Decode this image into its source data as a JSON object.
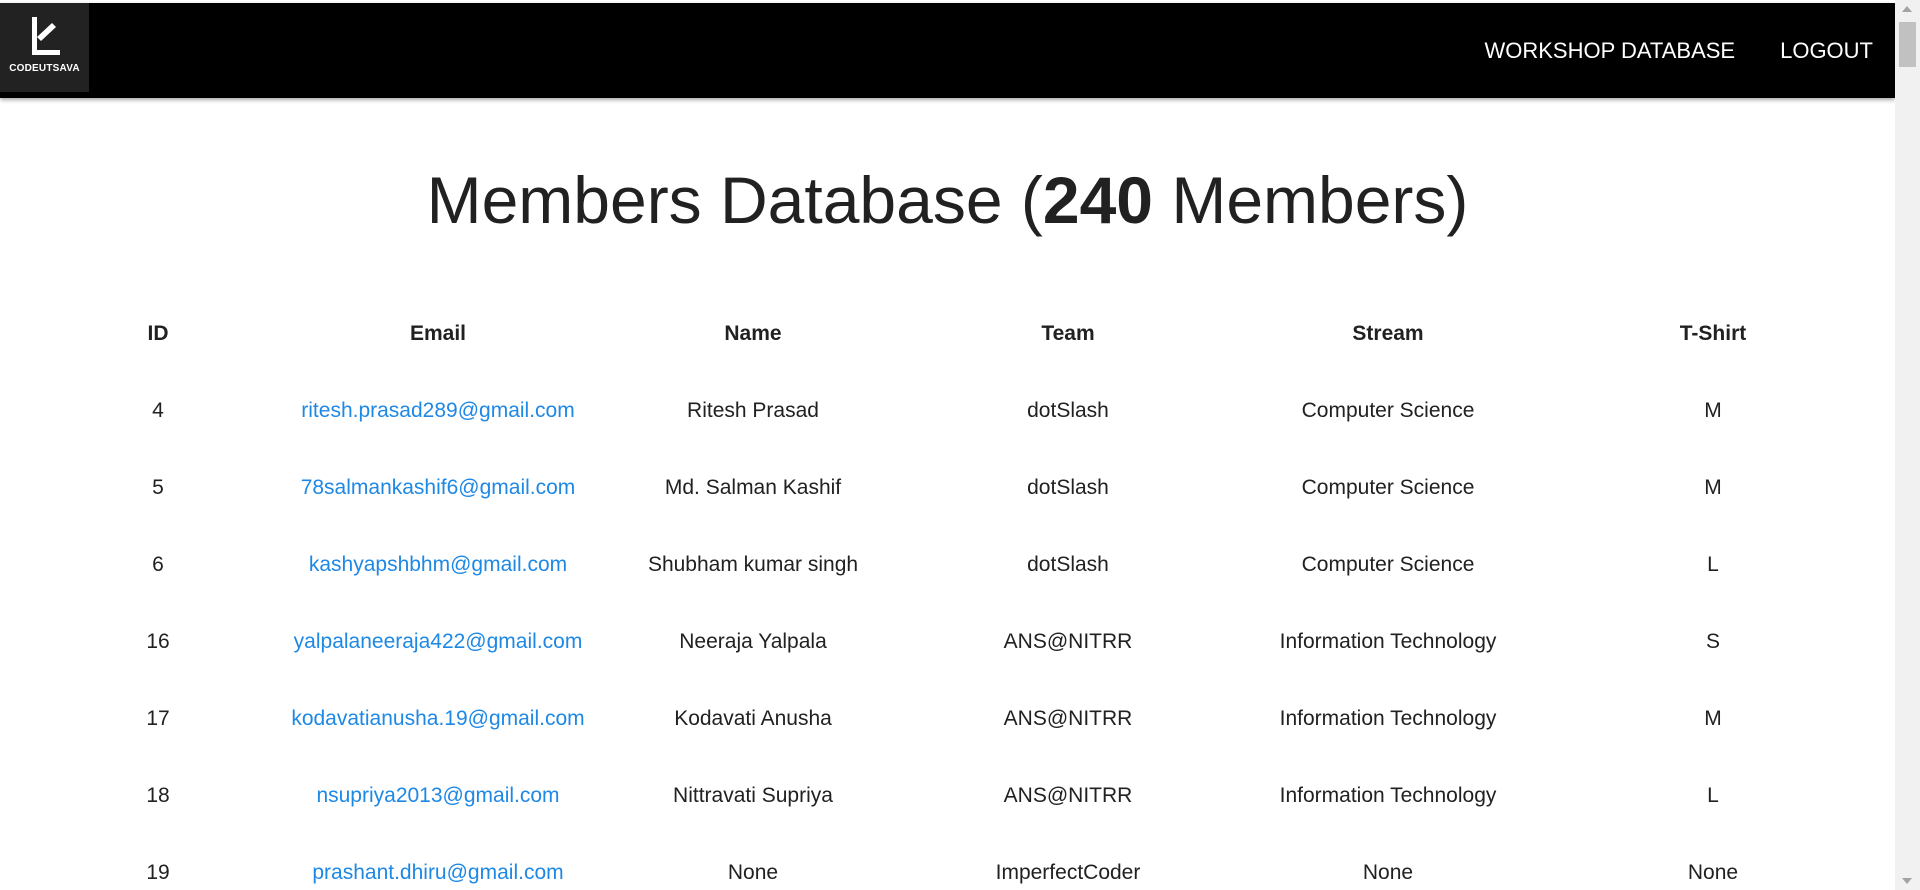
{
  "navbar": {
    "logo_text": "CODEUTSAVA",
    "links": [
      "WORKSHOP DATABASE",
      "LOGOUT"
    ]
  },
  "title": {
    "prefix": "Members Database (",
    "count": "240",
    "suffix": " Members)"
  },
  "table": {
    "headers": [
      "ID",
      "Email",
      "Name",
      "Team",
      "Stream",
      "T-Shirt"
    ],
    "rows": [
      {
        "id": "4",
        "email": "ritesh.prasad289@gmail.com",
        "name": "Ritesh Prasad",
        "team": "dotSlash",
        "stream": "Computer Science",
        "tshirt": "M"
      },
      {
        "id": "5",
        "email": "78salmankashif6@gmail.com",
        "name": "Md. Salman Kashif",
        "team": "dotSlash",
        "stream": "Computer Science",
        "tshirt": "M"
      },
      {
        "id": "6",
        "email": "kashyapshbhm@gmail.com",
        "name": "Shubham kumar singh",
        "team": "dotSlash",
        "stream": "Computer Science",
        "tshirt": "L"
      },
      {
        "id": "16",
        "email": "yalpalaneeraja422@gmail.com",
        "name": "Neeraja Yalpala",
        "team": "ANS@NITRR",
        "stream": "Information Technology",
        "tshirt": "S"
      },
      {
        "id": "17",
        "email": "kodavatianusha.19@gmail.com",
        "name": "Kodavati Anusha",
        "team": "ANS@NITRR",
        "stream": "Information Technology",
        "tshirt": "M"
      },
      {
        "id": "18",
        "email": "nsupriya2013@gmail.com",
        "name": "Nittravati Supriya",
        "team": "ANS@NITRR",
        "stream": "Information Technology",
        "tshirt": "L"
      },
      {
        "id": "19",
        "email": "prashant.dhiru@gmail.com",
        "name": "None",
        "team": "ImperfectCoder",
        "stream": "None",
        "tshirt": "None"
      }
    ]
  },
  "colors": {
    "navbar_bg": "#000000",
    "logo_bg": "#222222",
    "link": "#1e88e5",
    "text": "#212121"
  },
  "icons": {
    "logo": "codeutsava-logo-icon"
  }
}
